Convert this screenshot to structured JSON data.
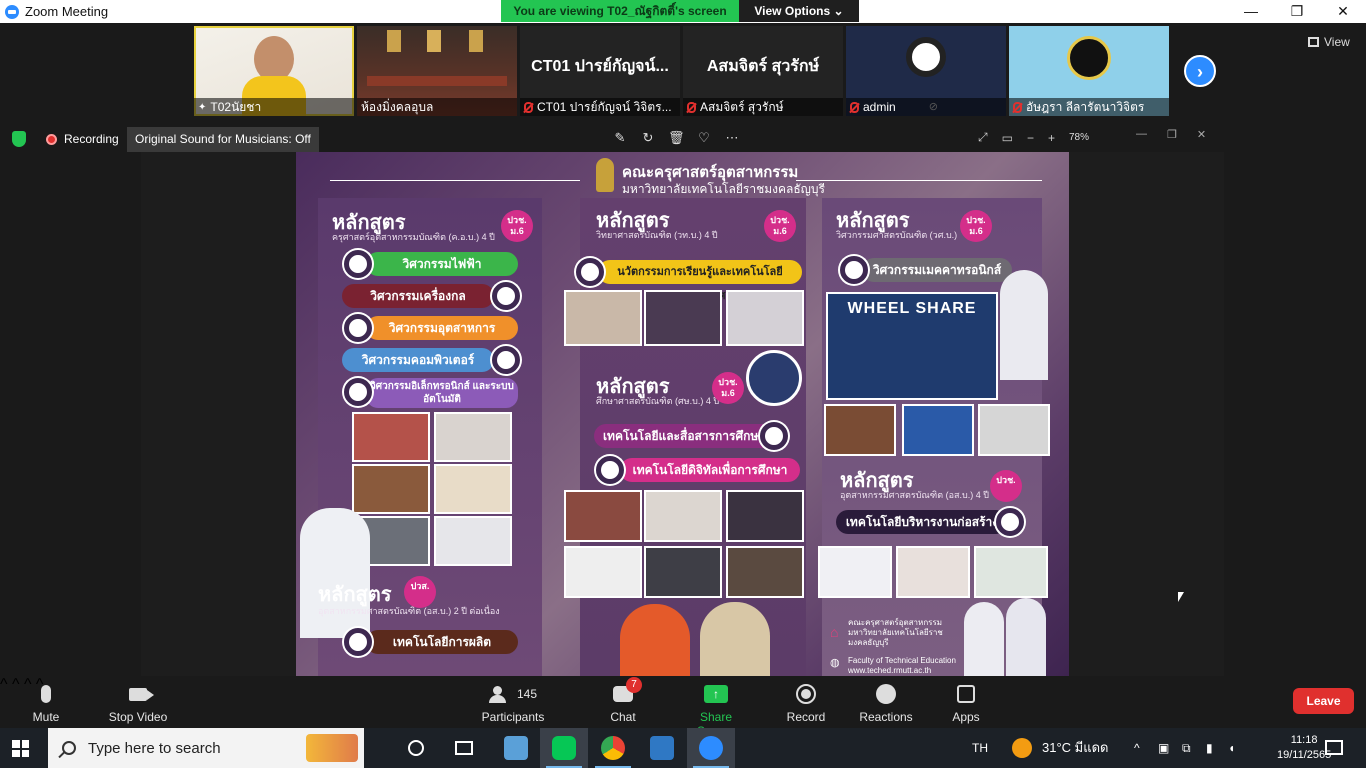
{
  "window": {
    "title": "Zoom Meeting",
    "viewing_banner": "You are viewing T02_ณัฐกิตติ์'s screen",
    "view_options": "View Options",
    "minimize": "—",
    "restore": "❐",
    "close": "✕"
  },
  "participants": [
    {
      "name": "T02นัยชา",
      "big_label": "",
      "muted": false
    },
    {
      "name": "ห้องมิ่งคลอุบล",
      "big_label": "",
      "muted": false
    },
    {
      "name": "CT01 ปารย์กัญจน์ วิจิตร...",
      "big_label": "CT01 ปารย์กัญจน์...",
      "muted": true
    },
    {
      "name": "Aสมจิตร์ สุวรักษ์",
      "big_label": "Aสมจิตร์ สุวรักษ์",
      "muted": true
    },
    {
      "name": "admin",
      "big_label": "",
      "muted": true
    },
    {
      "name": "อัษฎรา ลีลารัตนาวิจิตร",
      "big_label": "",
      "muted": true
    }
  ],
  "strip": {
    "next": "›",
    "view_label": "View"
  },
  "recording": {
    "label": "Recording",
    "original_sound": "Original Sound for Musicians: Off"
  },
  "share_toolbar": {
    "zoom_pct": "78%"
  },
  "poster": {
    "header_title": "คณะครุศาสตร์อุตสาหกรรม",
    "header_sub": "มหาวิทยาลัยเทคโนโลยีราชมงคลธัญบุรี",
    "col1": {
      "title": "หลักสูตร",
      "sub": "ครุศาสตร์อุตสาหกรรมบัณฑิต (ค.อ.บ.) 4 ปี",
      "badge": "ปวช. ม.6",
      "programs": [
        "วิศวกรรมไฟฟ้า",
        "วิศวกรรมเครื่องกล",
        "วิศวกรรมอุตสาหการ",
        "วิศวกรรมคอมพิวเตอร์",
        "วิศวกรรมอิเล็กทรอนิกส์ และระบบอัตโนมัติ"
      ],
      "title2": "หลักสูตร",
      "sub2": "อุตสาหกรรมศาสตรบัณฑิต (อส.บ.) 2 ปี ต่อเนื่อง",
      "badge2": "ปวส.",
      "program2": "เทคโนโลยีการผลิต"
    },
    "col2": {
      "title": "หลักสูตร",
      "sub": "วิทยาศาสตรบัณฑิต (วท.บ.) 4 ปี",
      "badge": "ปวช. ม.6",
      "program": "นวัตกรรมการเรียนรู้และเทคโนโลยีสารสนเทศ",
      "title2": "หลักสูตร",
      "sub2": "ศึกษาศาสตรบัณฑิต (ศษ.บ.) 4 ปี",
      "badge2": "ปวช. ม.6",
      "programs2": [
        "เทคโนโลยีและสื่อสารการศึกษา",
        "เทคโนโลยีดิจิทัลเพื่อการศึกษา"
      ]
    },
    "col3": {
      "title": "หลักสูตร",
      "sub": "วิศวกรรมศาสตรบัณฑิต (วศ.บ.)",
      "badge": "ปวช. ม.6",
      "program": "วิศวกรรมเมคคาทรอนิกส์",
      "wheel": "WHEEL SHARE",
      "title2": "หลักสูตร",
      "sub2": "อุตสาหกรรมศาสตรบัณฑิต (อส.บ.) 4 ปี",
      "badge2": "ปวช.",
      "program2": "เทคโนโลยีบริหารงานก่อสร้าง",
      "footer_org": "คณะครุศาสตร์อุตสาหกรรม มหาวิทยาลัยเทคโนโลยีราชมงคลธัญบุรี",
      "footer_en": "Faculty of Technical Education",
      "footer_url": "www.teched.rmutt.ac.th"
    }
  },
  "controls": {
    "mute": "Mute",
    "stop_video": "Stop Video",
    "participants": "Participants",
    "participants_count": "145",
    "chat": "Chat",
    "chat_badge": "7",
    "share_screen": "Share Screen",
    "record": "Record",
    "reactions": "Reactions",
    "apps": "Apps",
    "leave": "Leave"
  },
  "taskbar": {
    "search_placeholder": "Type here to search",
    "lang": "TH",
    "weather": "31°C มีแดด",
    "time": "11:18",
    "date": "19/11/2565"
  },
  "colors": {
    "accent": "#2d8cff",
    "share_green": "#23c552",
    "leave_red": "#e0302e",
    "poster_pink": "#d42e8a"
  }
}
